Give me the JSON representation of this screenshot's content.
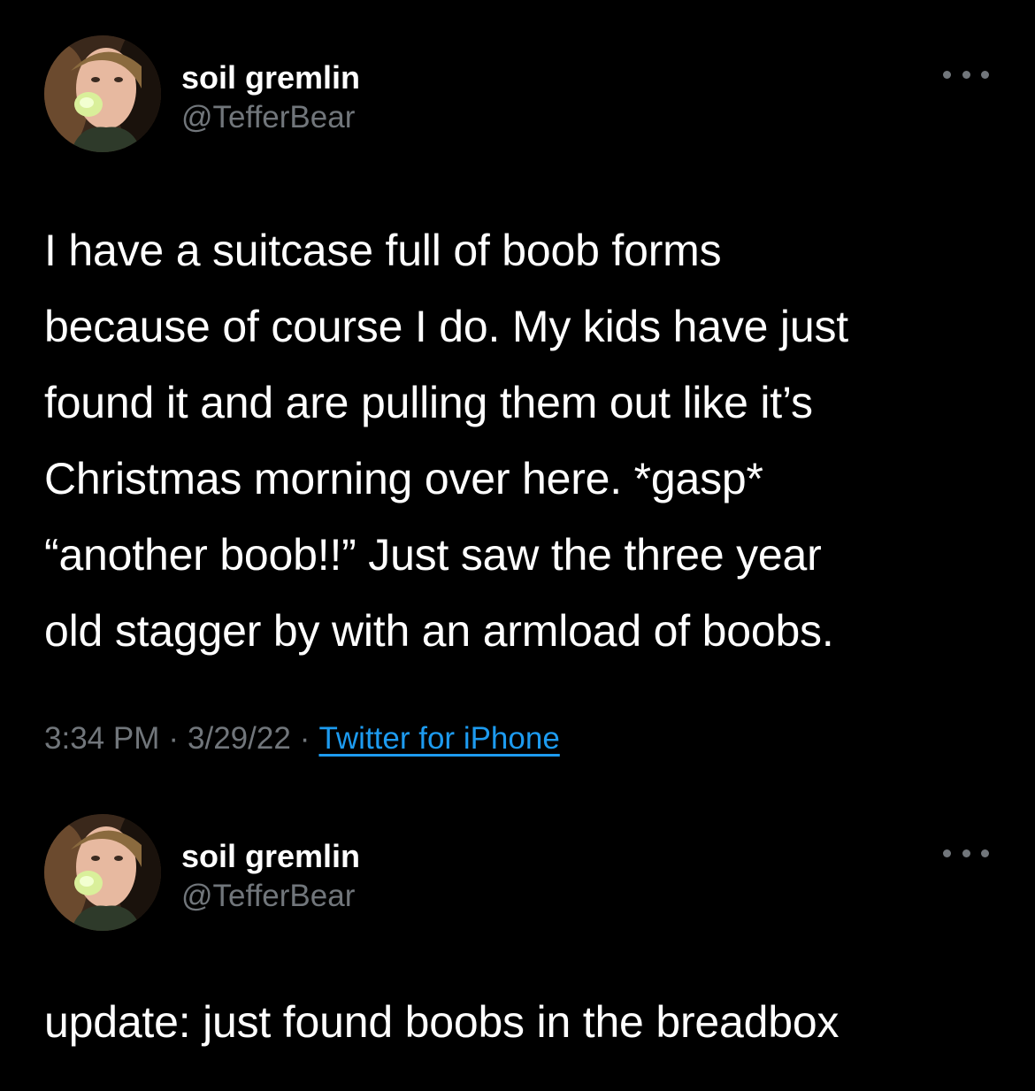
{
  "tweets": [
    {
      "author_name": "soil gremlin",
      "author_handle": "@TefferBear",
      "text": "I have a suitcase full of boob forms\nbecause of course I do. My kids have just\nfound it and are pulling them out like it’s\nChristmas morning over here. *gasp*\n“another boob!!” Just saw the three year\nold stagger by with an armload of boobs.",
      "time": "3:34 PM",
      "date": "3/29/22",
      "source": "Twitter for iPhone",
      "separator": "·"
    },
    {
      "author_name": "soil gremlin",
      "author_handle": "@TefferBear",
      "text": "update: just found boobs in the breadbox"
    }
  ],
  "icons": {
    "more": "more-options-icon",
    "avatar": "profile-photo"
  },
  "colors": {
    "background": "#000000",
    "text_primary": "#ffffff",
    "text_secondary": "#71767b",
    "link": "#1d9bf0"
  }
}
